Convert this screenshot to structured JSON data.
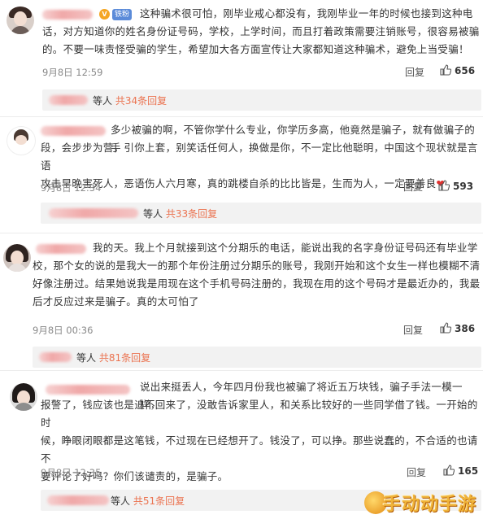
{
  "comments": [
    {
      "lines": [
        "这种骗术很可怕，刚毕业戒心都没有，我刚毕业一年的时候也接到这种电",
        "话，对方知道你的姓名身份证号码，学校，上学时间，而且打着政策需要注销账号，很容易被骗",
        "的。不要一味责怪受骗的学生，希望加大各方面宣传让大家都知道这种骗术，避免上当受骗！"
      ],
      "badge": "铁粉",
      "time": "9月8日 12:59",
      "reply": "回复",
      "likes": "656",
      "sub_suffix": "等人",
      "sub_count": "共34条回复"
    },
    {
      "lines": [
        "多少被骗的啊，不管你学什么专业，你学历多高，他竟然是骗子，就有做骗子的手",
        "段，会步步为营，引你上套，别笑话任何人，换做是你，不一定比他聪明，中国这个现状就是言语",
        "攻击早晚害死人，恶语伤人六月寒，真的跳楼自杀的比比皆是，生而为人，一定要善良"
      ],
      "time": "9月8日 12:34",
      "reply": "回复",
      "likes": "593",
      "sub_suffix": "等人",
      "sub_count": "共33条回复"
    },
    {
      "lines": [
        "我的天。我上个月就接到这个分期乐的电话，能说出我的名字身份证号码还有毕业学",
        "校，那个女的说的是我大一的那个年份注册过分期乐的账号，我刚开始和这个女生一样也模糊不清",
        "好像注册过。结果她说我是用现在这个手机号码注册的，我现在用的这个号码才是最近办的，我最",
        "后才反应过来是骗子。真的太可怕了"
      ],
      "time": "9月8日 00:36",
      "reply": "回复",
      "likes": "386",
      "sub_suffix": "等人",
      "sub_count": "共81条回复"
    },
    {
      "lines": [
        "说出来挺丢人，今年四月份我也被骗了将近五万块钱，骗子手法一模一样，",
        "报警了，钱应该也是追不回来了，没敢告诉家里人，和关系比较好的一些同学借了钱。一开始的时",
        "候，睁眼闭眼都是这笔钱，不过现在已经想开了。钱没了，可以挣。那些说蠢的，不合适的也请不",
        "要评论了好吗？你们该谴责的，是骗子。"
      ],
      "time": "9月8日 12:35",
      "reply": "回复",
      "likes": "165",
      "sub_suffix": "等人",
      "sub_count": "共51条回复"
    }
  ],
  "watermark": "手动动手游",
  "colors": {
    "accent": "#eb7350",
    "badge": "#5b8bd9",
    "heart": "#e0312f"
  }
}
